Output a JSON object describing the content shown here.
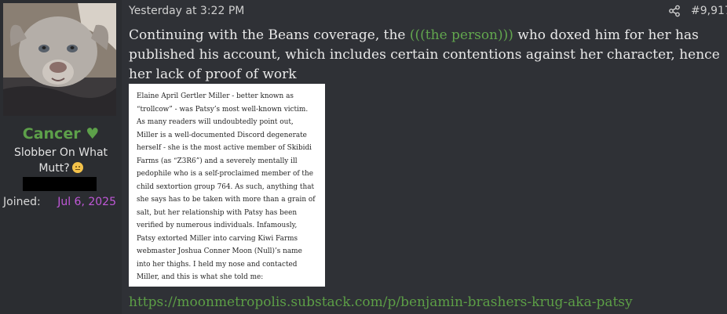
{
  "author": {
    "username": "Cancer ♥",
    "title_line1": "Slobber On What",
    "title_line2": "Mutt?",
    "title_emoji": "thinking-face-emoji",
    "joined_label": "Joined:",
    "joined_value": "Jul 6, 2025",
    "avatar": "puppy-avatar"
  },
  "post": {
    "timestamp": "Yesterday at 3:22 PM",
    "share_icon": "share-icon",
    "number": "#9,917",
    "body_before": "Continuing with the Beans coverage, the ",
    "echo": "(((the person)))",
    "body_after": " who doxed him for her has published his account, which includes certain contentions against her character, hence her lack of proof of work",
    "link": "https://moonmetropolis.substack.com/p/benjamin-brashers-krug-aka-patsy"
  },
  "article_image": {
    "lines": [
      "Elaine April Gertler Miller - better known as",
      "“trollcow” - was Patsy’s most well-known victim.",
      "As many readers will undoubtedly point out,",
      "Miller is a well-documented Discord degenerate",
      "herself - she is the most active member of Skibidi",
      "Farms (as “Z3R6”) and a severely mentally ill",
      "pedophile who is a self-proclaimed member of the",
      "child sextortion group 764. As such, anything that",
      "she says has to be taken with more than a grain of",
      "salt, but her relationship with Patsy has been",
      "verified by numerous individuals. Infamously,",
      "Patsy extorted Miller into carving Kiwi Farms",
      "webmaster Joshua Conner Moon (Null)’s name",
      "into her thighs. I held my nose and contacted",
      "Miller, and this is what she told me:"
    ]
  },
  "colors": {
    "background": "#2f3136",
    "sidebar": "#2b2d31",
    "username": "#5da04a",
    "joined_value": "#c058d8",
    "echo": "#62a64e",
    "link": "#5c9e46"
  }
}
